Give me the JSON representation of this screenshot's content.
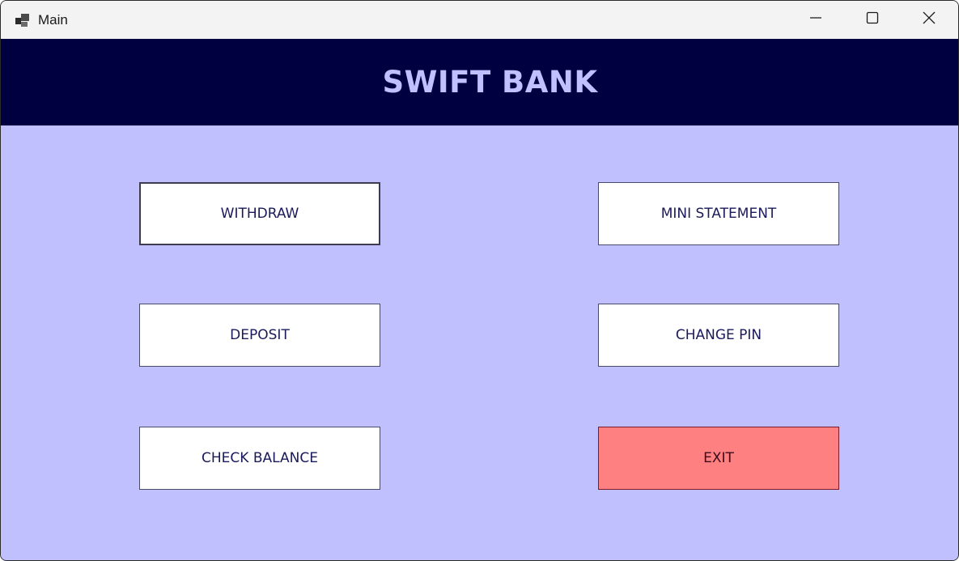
{
  "window": {
    "title": "Main",
    "icons": {
      "app": "app-window-icon",
      "minimize": "minimize-icon",
      "maximize": "maximize-icon",
      "close": "close-icon"
    }
  },
  "header": {
    "title": "SWIFT BANK"
  },
  "menu": {
    "withdraw": "WITHDRAW",
    "deposit": "DEPOSIT",
    "check_balance": "CHECK BALANCE",
    "mini_statement": "MINI STATEMENT",
    "change_pin": "CHANGE PIN",
    "exit": "EXIT"
  },
  "colors": {
    "header_bg": "#000040",
    "body_bg": "#c0c0ff",
    "title_fg": "#c0c0ff",
    "exit_bg": "#ff8080"
  }
}
